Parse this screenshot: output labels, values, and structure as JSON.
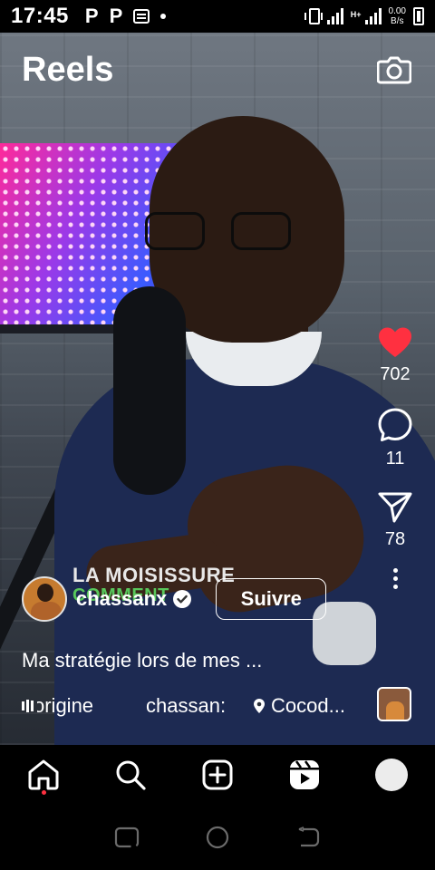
{
  "status_bar": {
    "time": "17:45",
    "left_icons": [
      "P",
      "P"
    ],
    "network_type": "H+",
    "net_speed_value": "0.00",
    "net_speed_unit": "B/s"
  },
  "header": {
    "title": "Reels",
    "camera_icon": "camera-icon"
  },
  "video_overlay": {
    "line1": "LA MOISISSURE",
    "line2": "COMMENT"
  },
  "actions": {
    "like_count": "702",
    "comment_count": "11",
    "share_count": "78",
    "like_color": "#ff3040"
  },
  "author": {
    "username": "chassanx",
    "follow_label": "Suivre"
  },
  "caption": "Ma stratégie lors de mes ...",
  "meta": {
    "audio": "origine",
    "collaborator": "chassan:",
    "location": "Cocod..."
  },
  "bottom_nav": {
    "items": [
      "home-icon",
      "search-icon",
      "create-icon",
      "reels-icon",
      "profile-avatar"
    ],
    "notification_dot_color": "#ff3040"
  }
}
